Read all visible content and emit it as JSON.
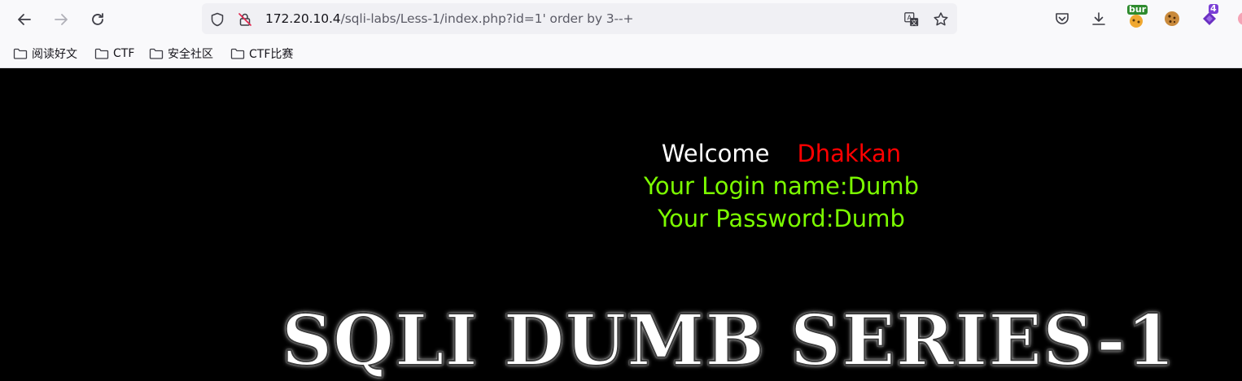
{
  "toolbar": {
    "url_host": "172.20.10.4",
    "url_path": "/sqli-labs/Less-1/index.php?id=1' order by 3--+",
    "extension_bur_label": "bur",
    "extension_badge_count": "4"
  },
  "bookmarks": {
    "items": [
      {
        "label": "阅读好文"
      },
      {
        "label": "CTF"
      },
      {
        "label": "安全社区"
      },
      {
        "label": "CTF比赛"
      }
    ]
  },
  "page": {
    "welcome_word": "Welcome",
    "welcome_name": "Dhakkan",
    "login_line": "Your Login name:Dumb",
    "password_line": "Your Password:Dumb",
    "banner_text": "SQLI DUMB SERIES-1"
  },
  "colors": {
    "background": "#000000",
    "welcome": "#ffffff",
    "name": "#ff0000",
    "info": "#7cfc00"
  }
}
